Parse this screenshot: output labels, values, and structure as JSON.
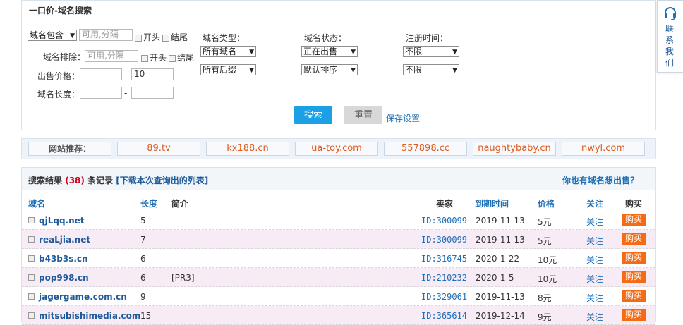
{
  "search": {
    "title": "一口价-域名搜索",
    "contains_select": "域名包含",
    "contains_placeholder": "可用,分隔",
    "exclude_label": "域名排除：",
    "exclude_placeholder": "可用,分隔",
    "opt_start": "开头",
    "opt_end": "结尾",
    "price_label": "出售价格：",
    "price_min": "",
    "price_max": "10",
    "dash": "-",
    "length_label": "域名长度：",
    "type_label": "域名类型：",
    "type_value": "所有域名",
    "suffix_value": "所有后缀",
    "status_label": "域名状态：",
    "status_value": "正在出售",
    "sort_value": "默认排序",
    "regtime_label": "注册时间：",
    "regtime_value": "不限",
    "expire_value": "不限",
    "search_button": "搜索",
    "reset_button": "重置",
    "save_link": "保存设置"
  },
  "sites": {
    "label": "网站推荐：",
    "items": [
      "89.tv",
      "kx188.cn",
      "ua-toy.com",
      "557898.cc",
      "naughtybaby.cn",
      "nwyl.com"
    ]
  },
  "results": {
    "prefix": "搜索结果",
    "count": "(38)",
    "suffix": "条记录",
    "download_link": "[下载本次查询出的列表]",
    "sell_link": "你也有域名想出售？",
    "headers": {
      "domain": "域名",
      "length": "长度",
      "intro": "简介",
      "seller": "卖家",
      "expire": "到期时间",
      "price": "价格",
      "follow": "关注",
      "buy": "购买"
    },
    "rows": [
      {
        "domain": "qjLqq.net",
        "length": "5",
        "intro": "",
        "seller": "ID:300099",
        "expire": "2019-11-13",
        "price": "5元",
        "follow": "关注",
        "buy": "购买"
      },
      {
        "domain": "reaLjia.net",
        "length": "7",
        "intro": "",
        "seller": "ID:300099",
        "expire": "2019-11-13",
        "price": "5元",
        "follow": "关注",
        "buy": "购买"
      },
      {
        "domain": "b43b3s.cn",
        "length": "6",
        "intro": "",
        "seller": "ID:316745",
        "expire": "2020-1-22",
        "price": "10元",
        "follow": "关注",
        "buy": "购买"
      },
      {
        "domain": "pop998.cn",
        "length": "6",
        "intro": "[PR3]",
        "seller": "ID:210232",
        "expire": "2020-1-5",
        "price": "10元",
        "follow": "关注",
        "buy": "购买"
      },
      {
        "domain": "jagergame.com.cn",
        "length": "9",
        "intro": "",
        "seller": "ID:329061",
        "expire": "2019-11-13",
        "price": "8元",
        "follow": "关注",
        "buy": "购买"
      },
      {
        "domain": "mitsubishimedia.com",
        "length": "15",
        "intro": "",
        "seller": "ID:365614",
        "expire": "2019-12-14",
        "price": "9元",
        "follow": "关注",
        "buy": "购买"
      }
    ]
  },
  "contact": {
    "text": "联系我们"
  },
  "colors": {
    "accent": "#1ba0e6",
    "buy": "#f56a14",
    "link": "#1f6fb5",
    "price_count": "#d0021b"
  }
}
